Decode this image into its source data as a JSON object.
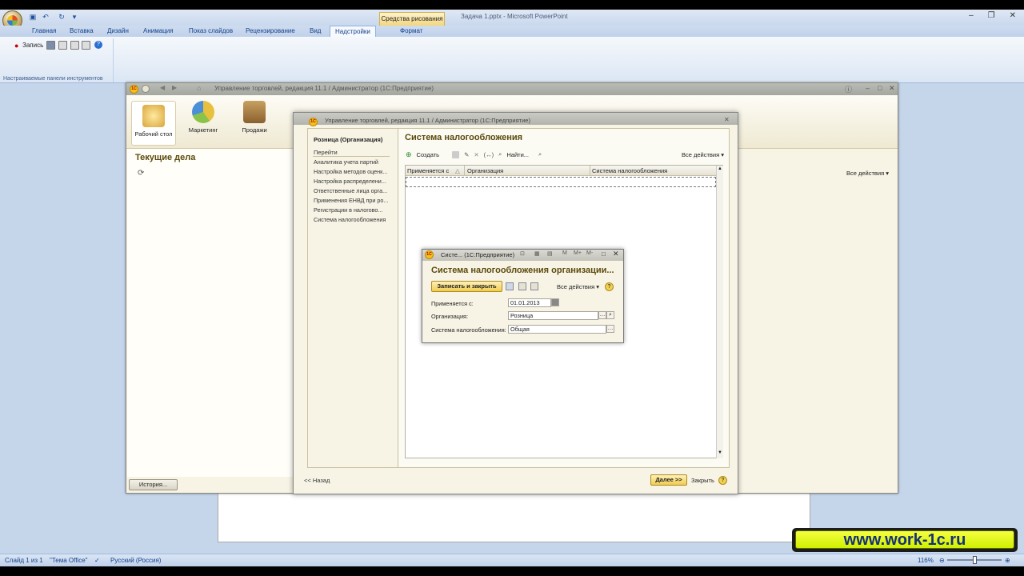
{
  "ppt": {
    "title_file": "Задача 1.pptx - Microsoft PowerPoint",
    "context_tab": "Средства рисования",
    "tabs": [
      "Главная",
      "Вставка",
      "Дизайн",
      "Анимация",
      "Показ слайдов",
      "Рецензирование",
      "Вид",
      "Надстройки",
      "Формат"
    ],
    "active_tab": "Надстройки",
    "record_label": "Запись",
    "group_caption": "Настраиваемые панели инструментов",
    "status": {
      "slide": "Слайд 1 из 1",
      "theme": "\"Тема Office\"",
      "lang": "Русский (Россия)",
      "zoom": "116%"
    }
  },
  "main1c": {
    "title": "Управление торговлей, редакция 11.1 / Администратор  (1С:Предприятие)",
    "sections": [
      {
        "label": "Рабочий стол",
        "icon": "desktop-icon"
      },
      {
        "label": "Маркетинг",
        "icon": "marketing-icon"
      },
      {
        "label": "Продажи",
        "icon": "sales-icon"
      }
    ],
    "current_tasks": "Текущие дела",
    "all_actions": "Все действия ▾",
    "history": "История..."
  },
  "helper": {
    "title": "Управление торговлей, редакция 11.1 / Администратор  (1С:Предприятие)",
    "nav_title": "Розница (Организация)",
    "nav_go": "Перейти",
    "nav_links": [
      "Аналитика учета партий",
      "Настройка методов оценк...",
      "Настройка распределени...",
      "Ответственные лица орга...",
      "Применения ЕНВД при ро...",
      "Регистрации в налогово...",
      "Система налогообложения"
    ],
    "content_title": "Система налогообложения",
    "create": "Создать",
    "find": "Найти...",
    "all_actions": "Все действия ▾",
    "columns": [
      "Применяется с",
      "Организация",
      "Система налогообложения"
    ],
    "back": "<< Назад",
    "next": "Далее >>",
    "close": "Закрыть"
  },
  "dialog": {
    "title": "Систе...  (1С:Предприятие)",
    "heading": "Система налогообложения организации...",
    "save_close": "Записать и закрыть",
    "all_actions": "Все действия ▾",
    "fields": [
      {
        "label": "Применяется с:",
        "value": "01.01.2013"
      },
      {
        "label": "Организация:",
        "value": "Розница"
      },
      {
        "label": "Система налогообложения:",
        "value": "Общая"
      }
    ]
  },
  "watermark": "www.work-1c.ru"
}
